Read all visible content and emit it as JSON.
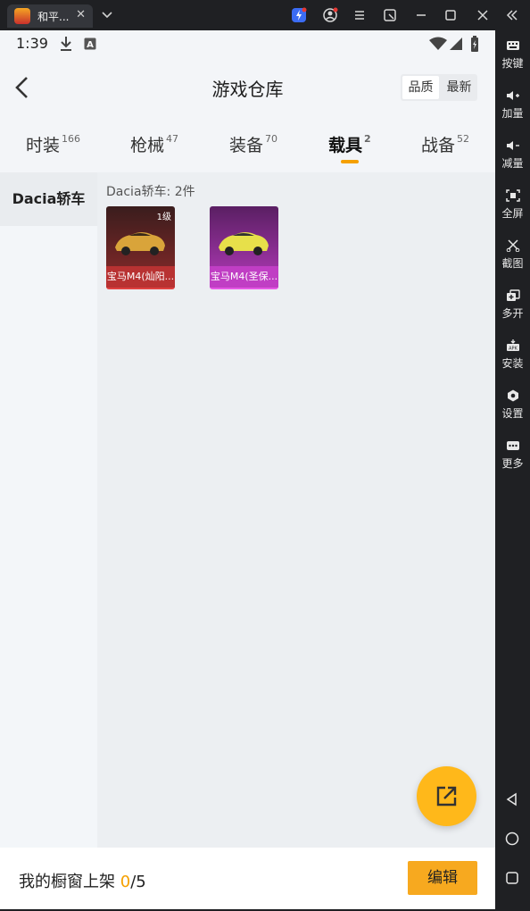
{
  "window": {
    "tab_title": "和平...",
    "tab_close": "✕"
  },
  "sidebar": {
    "items": [
      {
        "label": "按键",
        "icon": "keyboard-icon"
      },
      {
        "label": "加量",
        "icon": "volume-up-icon"
      },
      {
        "label": "减量",
        "icon": "volume-down-icon"
      },
      {
        "label": "全屏",
        "icon": "fullscreen-icon"
      },
      {
        "label": "截图",
        "icon": "scissors-icon"
      },
      {
        "label": "多开",
        "icon": "multi-instance-icon"
      },
      {
        "label": "安装",
        "icon": "apk-install-icon"
      },
      {
        "label": "设置",
        "icon": "settings-icon"
      },
      {
        "label": "更多",
        "icon": "more-icon"
      }
    ]
  },
  "status": {
    "time": "1:39"
  },
  "header": {
    "title": "游戏仓库",
    "sort_options": [
      "品质",
      "最新"
    ],
    "sort_selected": "品质"
  },
  "tabs": [
    {
      "label": "时装",
      "count": "166"
    },
    {
      "label": "枪械",
      "count": "47"
    },
    {
      "label": "装备",
      "count": "70"
    },
    {
      "label": "载具",
      "count": "2",
      "active": true
    },
    {
      "label": "战备",
      "count": "52"
    }
  ],
  "left_menu": {
    "selected": "Dacia轿车"
  },
  "content": {
    "section_title": "Dacia轿车: 2件",
    "items": [
      {
        "name": "宝马M4(灿阳...",
        "level": "1级",
        "bg": "#8b2a2a"
      },
      {
        "name": "宝马M4(圣保...",
        "bg": "#8a2b8a"
      }
    ]
  },
  "footer": {
    "label_prefix": "我的橱窗上架 ",
    "shelved": "0",
    "separator": "/",
    "total": "5",
    "edit_label": "编辑"
  },
  "colors": {
    "accent": "#f5a000",
    "fab": "#ffb81a",
    "edit_button": "#f7a91f"
  }
}
